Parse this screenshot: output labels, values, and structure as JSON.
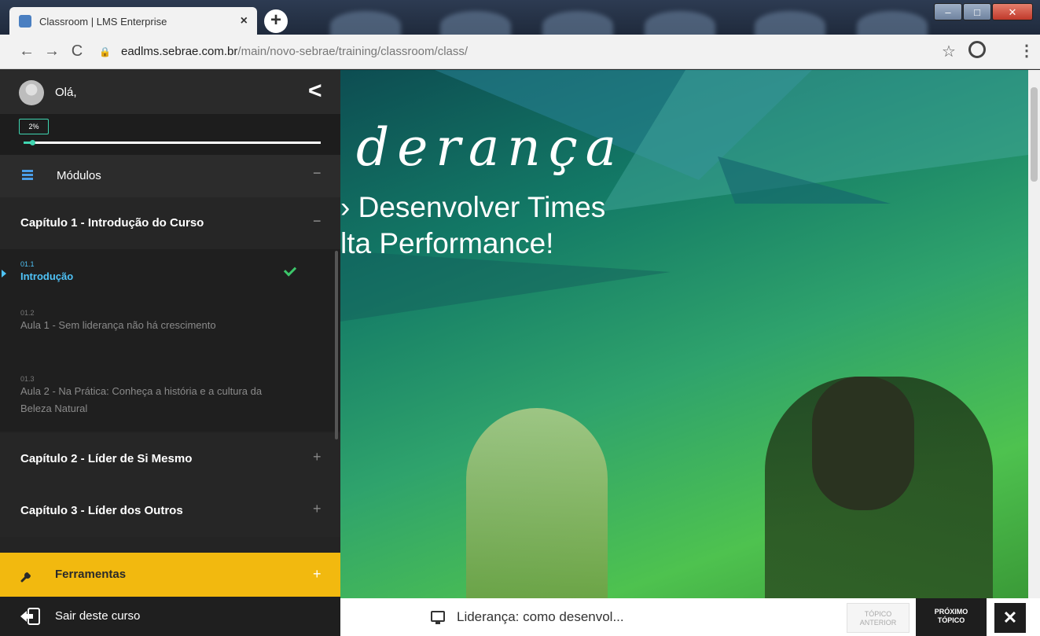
{
  "browser": {
    "tab_title": "Classroom | LMS Enterprise",
    "tab_close": "×",
    "new_tab": "+",
    "url_host": "eadlms.sebrae.com.br",
    "url_path": "/main/novo-sebrae/training/classroom/class/"
  },
  "sidebar": {
    "greeting": "Olá,",
    "progress": {
      "label": "2%",
      "value": 0.02
    },
    "modules_label": "Módulos",
    "chapters": [
      {
        "label": "Capítulo 1 - Introdução do Curso",
        "toggle": "−"
      },
      {
        "label": "Capítulo 2 - Líder de Si Mesmo",
        "toggle": "+"
      },
      {
        "label": "Capítulo 3 - Líder dos Outros",
        "toggle": "+"
      }
    ],
    "lessons": [
      {
        "num": "01.1",
        "title": "Introdução",
        "completed": true
      },
      {
        "num": "01.2",
        "title": "Aula 1 - Sem liderança não há crescimento"
      },
      {
        "num": "01.3",
        "title": "Aula 2 - Na Prática: Conheça a história e a cultura da Beleza Natural"
      }
    ],
    "tools_label": "Ferramentas",
    "exit_label": "Sair deste curso"
  },
  "content": {
    "headline_script": "derança",
    "headline_line1": "› Desenvolver Times",
    "headline_line2": "lta Performance!"
  },
  "footer": {
    "topic_title": "Liderança: como desenvol...",
    "prev_label": [
      "TÓPICO",
      "ANTERIOR"
    ],
    "next_label": [
      "PRÓXIMO",
      "TÓPICO"
    ],
    "fullscreen_glyph": "✕"
  },
  "colors": {
    "accent_teal": "#3fd5b0",
    "active_blue": "#4fc3f7",
    "tools_yellow": "#f2b90f",
    "check_green": "#3cc66a"
  }
}
